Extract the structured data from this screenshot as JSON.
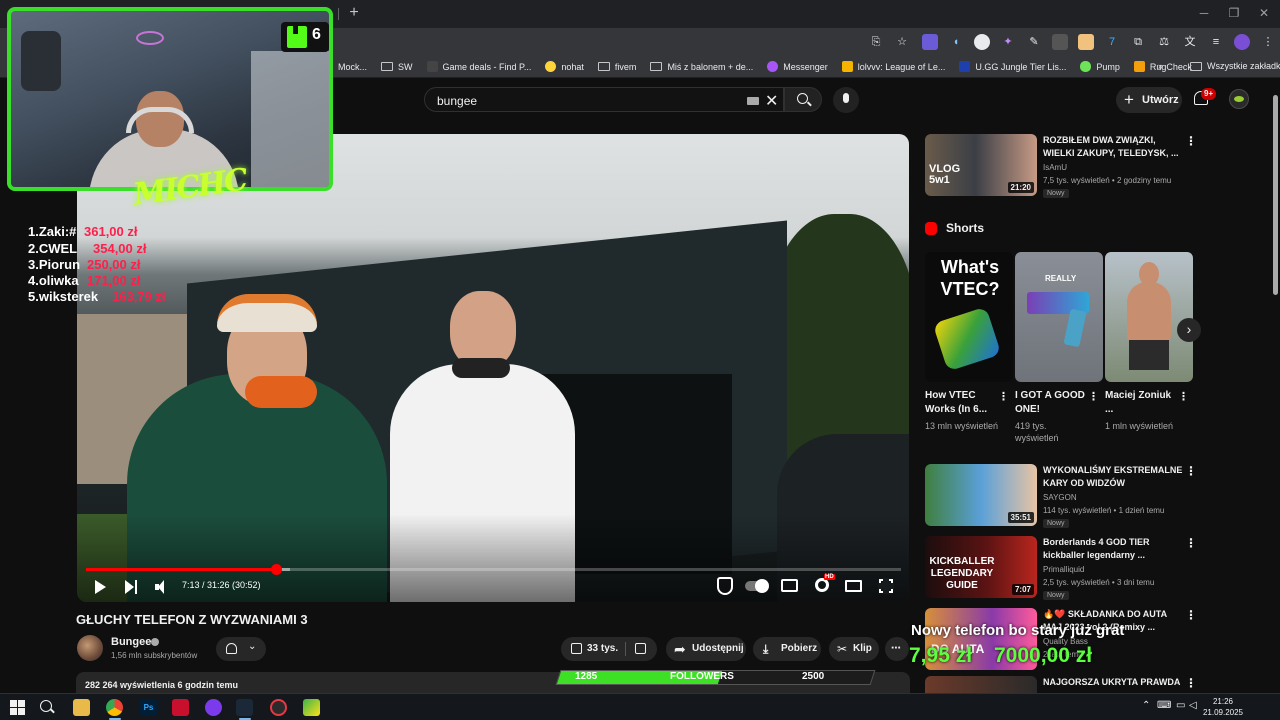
{
  "search": {
    "query": "bungee"
  },
  "header": {
    "create_label": "Utwórz",
    "notif_count": "9+"
  },
  "bookmarks": [
    {
      "label": "Mock...",
      "icon": "blank"
    },
    {
      "label": "SW",
      "icon": "folder"
    },
    {
      "label": "Game deals - Find P...",
      "icon": "gg-icon"
    },
    {
      "label": "nohat",
      "icon": "yellow-face-icon"
    },
    {
      "label": "fivem",
      "icon": "folder"
    },
    {
      "label": "Miś z balonem + de...",
      "icon": "folder"
    },
    {
      "label": "Messenger",
      "icon": "messenger-icon"
    },
    {
      "label": "lolvvv: League of Le...",
      "icon": "lolvvv-icon"
    },
    {
      "label": "U.GG Jungle Tier Lis...",
      "icon": "ugg-icon"
    },
    {
      "label": "Pump",
      "icon": "pill-icon"
    },
    {
      "label": "RugCheck",
      "icon": "rugcheck-icon"
    }
  ],
  "bookmarks_all": "Wszystkie zakładki",
  "player": {
    "time": "7:13 / 31:26 (30:52)",
    "progress": 0.233,
    "buffered": 0.25
  },
  "video": {
    "title": "GŁUCHY TELEFON Z WYZWANIAMI 3",
    "channel": "Bungee",
    "subs": "1,56 mln subskrybentów",
    "likes": "33 tys.",
    "share": "Udostępnij",
    "download": "Pobierz",
    "clip": "Klip",
    "views": "282 264 wyświetlenia  6 godzin temu"
  },
  "sidebar": {
    "top": {
      "title": "ROZBIŁEM DWA ZWIĄZKI, WIELKI ZAKUPY, TELEDYSK, ...",
      "channel": "IsAmU",
      "meta": "7,5 tys. wyświetleń • 2 godziny temu",
      "badge": "Nowy",
      "duration": "21:20",
      "thumb_text": "VLOG 5w1"
    },
    "shorts_label": "Shorts",
    "shorts": [
      {
        "title": "How VTEC Works (In 6...",
        "views": "13 mln wyświetleń",
        "thumb_text": "What's VTEC?"
      },
      {
        "title": "I GOT A GOOD ONE!",
        "views": "419 tys. wyświetleń",
        "thumb_text": "REALLY"
      },
      {
        "title": "Maciej Zoniuk ...",
        "views": "1 mln wyświetleń",
        "thumb_text": ""
      }
    ],
    "videos": [
      {
        "title": "WYKONALIŚMY EKSTREMALNE KARY OD WIDZÓW",
        "channel": "SAYGON",
        "meta": "114 tys. wyświetleń • 1 dzień temu",
        "badge": "Nowy",
        "duration": "35:51",
        "thumb_text": ""
      },
      {
        "title": "Borderlands 4 GOD TIER kickballer legendarny ...",
        "channel": "Primalliquid",
        "meta": "2,5 tys. wyświetleń • 3 dni temu",
        "badge": "Nowy",
        "duration": "7:07",
        "thumb_text": "KICKBALLER LEGENDARY GUIDE"
      },
      {
        "title": "🔥❤️ SKŁADANKA DO AUTA MAJ 2023 vol.2 (Remixy ...",
        "channel": "Quality Bass",
        "meta": "2 lata temu",
        "badge": "",
        "duration": "",
        "thumb_text": "DO AUTA"
      },
      {
        "title": "NAJGORSZA UKRYTA PRAWDA ...",
        "channel": "",
        "meta": "",
        "badge": "",
        "duration": "",
        "thumb_text": ""
      }
    ]
  },
  "stream": {
    "kick_viewers": "6",
    "neon_name": "MICHC",
    "donors": [
      {
        "name": "1.Zaki:#",
        "amount": "361,00 zł"
      },
      {
        "name": "2.CWEL",
        "amount": "354,00 zł"
      },
      {
        "name": "3.Piorun",
        "amount": "250,00 zł"
      },
      {
        "name": "4.oliwka",
        "amount": "171,00 zł"
      },
      {
        "name": "5.wiksterek",
        "amount": "163,79 zł"
      }
    ],
    "goal_title": "Nowy telefon bo stary już grat",
    "goal_current": "7,95 zł",
    "goal_target": "7000,00 zł",
    "followers_current": "1285",
    "followers_label": "FOLLOWERS",
    "followers_goal": "2500",
    "followers_fraction": 0.514
  },
  "taskbar": {
    "time": "21:26",
    "date": "21.09.2025"
  },
  "colors": {
    "accent_green": "#3adf2a",
    "yt_red": "#ff0000",
    "donor_red": "#ff1f4b"
  }
}
